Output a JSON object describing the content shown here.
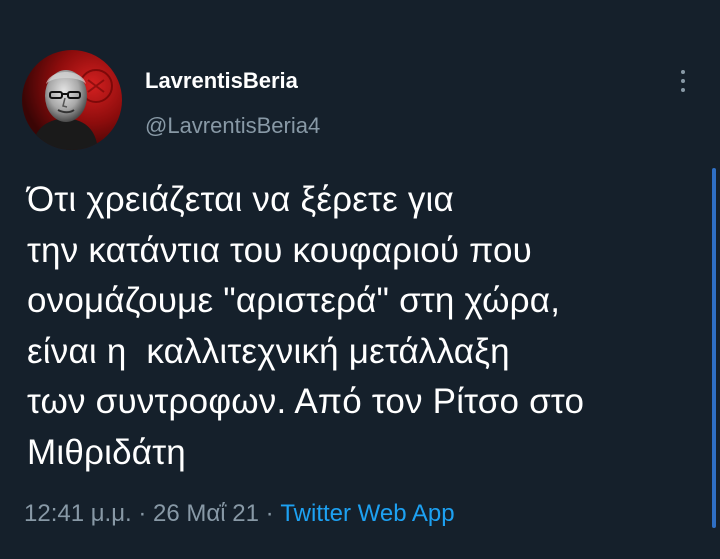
{
  "author": {
    "display_name": "LavrentisBeria",
    "handle": "@LavrentisBeria4",
    "avatar_icon": "profile-photo"
  },
  "more_icon": "more-vertical-icon",
  "tweet": {
    "lines": [
      "Ότι χρειάζεται να ξέρετε για",
      "την κατάντια του κουφαριού που",
      "ονομάζουμε \"αριστερά\" στη χώρα,",
      "είναι η  καλλιτεχνική μετάλλαξη",
      "των συντροφων. Από τον Ρίτσο στο",
      "Μιθριδάτη"
    ]
  },
  "meta": {
    "time": "12:41 μ.μ.",
    "separator1": " · ",
    "date": "26 Μαΐ 21",
    "separator2": " · ",
    "source": "Twitter Web App"
  },
  "colors": {
    "background": "#15202b",
    "text": "#ffffff",
    "secondary": "#8899a6",
    "link": "#1da1f2"
  }
}
